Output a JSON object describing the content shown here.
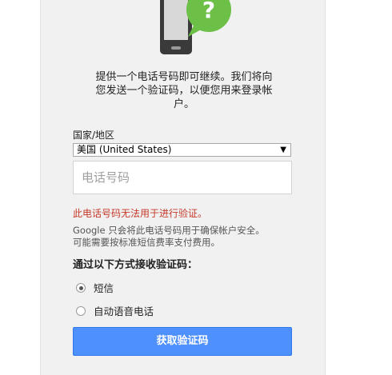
{
  "intro": {
    "line1": "提供一个电话号码即可继续。我们将向",
    "line2": "您发送一个验证码，以便您用来登录帐",
    "line3": "户。"
  },
  "form": {
    "country_label": "国家/地区",
    "country_value": "美国 (United States)",
    "phone_placeholder": "电话号码",
    "error_text": "此电话号码无法用于进行验证。",
    "note_line1": "Google 只会将此电话号码用于确保帐户安全。",
    "note_line2": "可能需要按标准短信费率支付费用。",
    "method_title": "通过以下方式接收验证码：",
    "options": [
      {
        "label": "短信",
        "selected": true
      },
      {
        "label": "自动语音电话",
        "selected": false
      }
    ],
    "submit_label": "获取验证码"
  },
  "colors": {
    "accent": "#4d90fe",
    "error": "#c53929",
    "illustration_green": "#6cbf47"
  },
  "icons": {
    "illustration": "phone-question-icon",
    "dropdown": "triangle-down-icon"
  }
}
